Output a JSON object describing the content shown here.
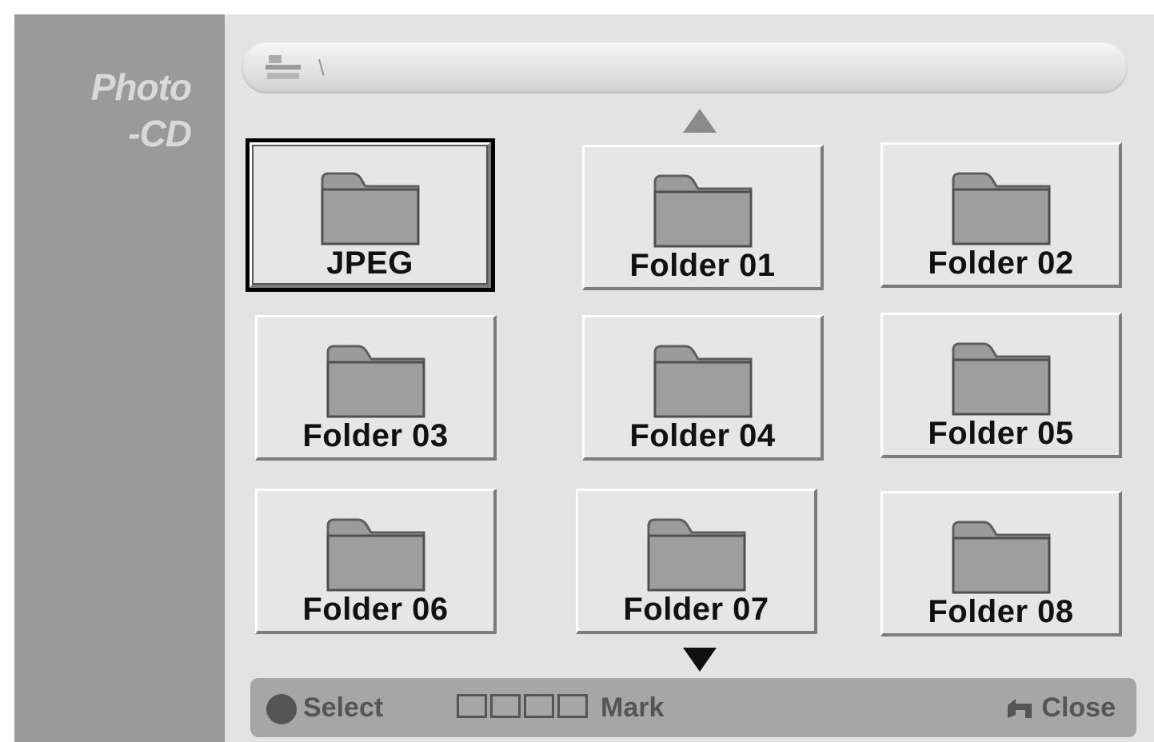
{
  "sidebar": {
    "title": "Photo\n-CD"
  },
  "pathbar": {
    "icon": "disc-drive-icon",
    "text": "\\"
  },
  "grid": {
    "items": [
      {
        "label": "JPEG",
        "selected": true
      },
      {
        "label": "Folder 01"
      },
      {
        "label": "Folder 02"
      },
      {
        "label": "Folder 03"
      },
      {
        "label": "Folder 04"
      },
      {
        "label": "Folder 05"
      },
      {
        "label": "Folder 06"
      },
      {
        "label": "Folder 07"
      },
      {
        "label": "Folder 08"
      }
    ]
  },
  "footer": {
    "select_label": "Select",
    "mark_label": "Mark",
    "close_label": "Close"
  },
  "colors": {
    "background": "#e3e3e3",
    "sidebar": "#9a9a9a",
    "footer": "#a6a6a6"
  }
}
